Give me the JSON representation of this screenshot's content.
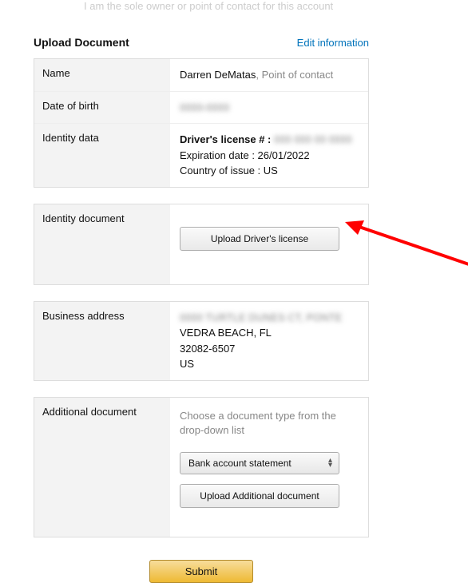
{
  "truncated_top": "I am the sole owner or point of contact for this account",
  "header": {
    "title": "Upload Document",
    "edit_link": "Edit information"
  },
  "info_panel": {
    "name": {
      "label": "Name",
      "value": "Darren DeMatas",
      "role_suffix": ", Point of contact"
    },
    "dob": {
      "label": "Date of birth",
      "value_hidden": "0000-0000"
    },
    "identity": {
      "label": "Identity data",
      "license_label": "Driver's license # :",
      "license_hidden": "000 000 00 0000",
      "expiration_line": "Expiration date : 26/01/2022",
      "country_line": "Country of issue : US"
    }
  },
  "identity_doc": {
    "label": "Identity document",
    "upload_btn": "Upload Driver's license"
  },
  "business_address": {
    "label": "Business address",
    "line1_hidden": "0000 TURTLE DUNES CT, PONTE",
    "line2": "VEDRA BEACH, FL",
    "line3": "32082-6507",
    "line4": "US"
  },
  "additional_doc": {
    "label": "Additional document",
    "instruction": "Choose a document type from the drop-down list",
    "selected_option": "Bank account statement",
    "upload_btn": "Upload Additional document"
  },
  "submit_label": "Submit"
}
